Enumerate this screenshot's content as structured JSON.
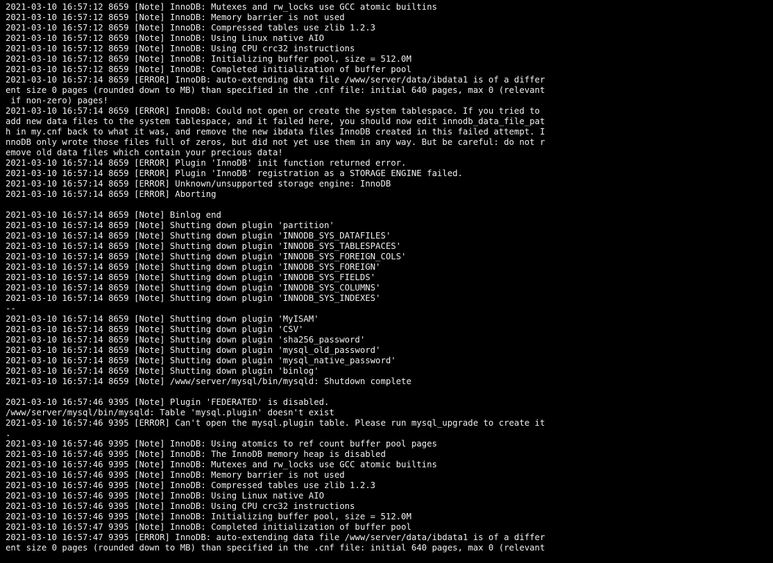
{
  "terminal": {
    "lines": [
      "2021-03-10 16:57:12 8659 [Note] InnoDB: Mutexes and rw_locks use GCC atomic builtins",
      "2021-03-10 16:57:12 8659 [Note] InnoDB: Memory barrier is not used",
      "2021-03-10 16:57:12 8659 [Note] InnoDB: Compressed tables use zlib 1.2.3",
      "2021-03-10 16:57:12 8659 [Note] InnoDB: Using Linux native AIO",
      "2021-03-10 16:57:12 8659 [Note] InnoDB: Using CPU crc32 instructions",
      "2021-03-10 16:57:12 8659 [Note] InnoDB: Initializing buffer pool, size = 512.0M",
      "2021-03-10 16:57:12 8659 [Note] InnoDB: Completed initialization of buffer pool",
      "2021-03-10 16:57:14 8659 [ERROR] InnoDB: auto-extending data file /www/server/data/ibdata1 is of a differ",
      "ent size 0 pages (rounded down to MB) than specified in the .cnf file: initial 640 pages, max 0 (relevant",
      " if non-zero) pages!",
      "2021-03-10 16:57:14 8659 [ERROR] InnoDB: Could not open or create the system tablespace. If you tried to",
      "add new data files to the system tablespace, and it failed here, you should now edit innodb_data_file_pat",
      "h in my.cnf back to what it was, and remove the new ibdata files InnoDB created in this failed attempt. I",
      "nnoDB only wrote those files full of zeros, but did not yet use them in any way. But be careful: do not r",
      "emove old data files which contain your precious data!",
      "2021-03-10 16:57:14 8659 [ERROR] Plugin 'InnoDB' init function returned error.",
      "2021-03-10 16:57:14 8659 [ERROR] Plugin 'InnoDB' registration as a STORAGE ENGINE failed.",
      "2021-03-10 16:57:14 8659 [ERROR] Unknown/unsupported storage engine: InnoDB",
      "2021-03-10 16:57:14 8659 [ERROR] Aborting",
      "",
      "2021-03-10 16:57:14 8659 [Note] Binlog end",
      "2021-03-10 16:57:14 8659 [Note] Shutting down plugin 'partition'",
      "2021-03-10 16:57:14 8659 [Note] Shutting down plugin 'INNODB_SYS_DATAFILES'",
      "2021-03-10 16:57:14 8659 [Note] Shutting down plugin 'INNODB_SYS_TABLESPACES'",
      "2021-03-10 16:57:14 8659 [Note] Shutting down plugin 'INNODB_SYS_FOREIGN_COLS'",
      "2021-03-10 16:57:14 8659 [Note] Shutting down plugin 'INNODB_SYS_FOREIGN'",
      "2021-03-10 16:57:14 8659 [Note] Shutting down plugin 'INNODB_SYS_FIELDS'",
      "2021-03-10 16:57:14 8659 [Note] Shutting down plugin 'INNODB_SYS_COLUMNS'",
      "2021-03-10 16:57:14 8659 [Note] Shutting down plugin 'INNODB_SYS_INDEXES'",
      "--",
      "2021-03-10 16:57:14 8659 [Note] Shutting down plugin 'MyISAM'",
      "2021-03-10 16:57:14 8659 [Note] Shutting down plugin 'CSV'",
      "2021-03-10 16:57:14 8659 [Note] Shutting down plugin 'sha256_password'",
      "2021-03-10 16:57:14 8659 [Note] Shutting down plugin 'mysql_old_password'",
      "2021-03-10 16:57:14 8659 [Note] Shutting down plugin 'mysql_native_password'",
      "2021-03-10 16:57:14 8659 [Note] Shutting down plugin 'binlog'",
      "2021-03-10 16:57:14 8659 [Note] /www/server/mysql/bin/mysqld: Shutdown complete",
      "",
      "2021-03-10 16:57:46 9395 [Note] Plugin 'FEDERATED' is disabled.",
      "/www/server/mysql/bin/mysqld: Table 'mysql.plugin' doesn't exist",
      "2021-03-10 16:57:46 9395 [ERROR] Can't open the mysql.plugin table. Please run mysql_upgrade to create it",
      ".",
      "2021-03-10 16:57:46 9395 [Note] InnoDB: Using atomics to ref count buffer pool pages",
      "2021-03-10 16:57:46 9395 [Note] InnoDB: The InnoDB memory heap is disabled",
      "2021-03-10 16:57:46 9395 [Note] InnoDB: Mutexes and rw_locks use GCC atomic builtins",
      "2021-03-10 16:57:46 9395 [Note] InnoDB: Memory barrier is not used",
      "2021-03-10 16:57:46 9395 [Note] InnoDB: Compressed tables use zlib 1.2.3",
      "2021-03-10 16:57:46 9395 [Note] InnoDB: Using Linux native AIO",
      "2021-03-10 16:57:46 9395 [Note] InnoDB: Using CPU crc32 instructions",
      "2021-03-10 16:57:46 9395 [Note] InnoDB: Initializing buffer pool, size = 512.0M",
      "2021-03-10 16:57:47 9395 [Note] InnoDB: Completed initialization of buffer pool",
      "2021-03-10 16:57:47 9395 [ERROR] InnoDB: auto-extending data file /www/server/data/ibdata1 is of a differ",
      "ent size 0 pages (rounded down to MB) than specified in the .cnf file: initial 640 pages, max 0 (relevant"
    ],
    "colors": {
      "background": "#000000",
      "text": "#f0f0f0"
    }
  }
}
